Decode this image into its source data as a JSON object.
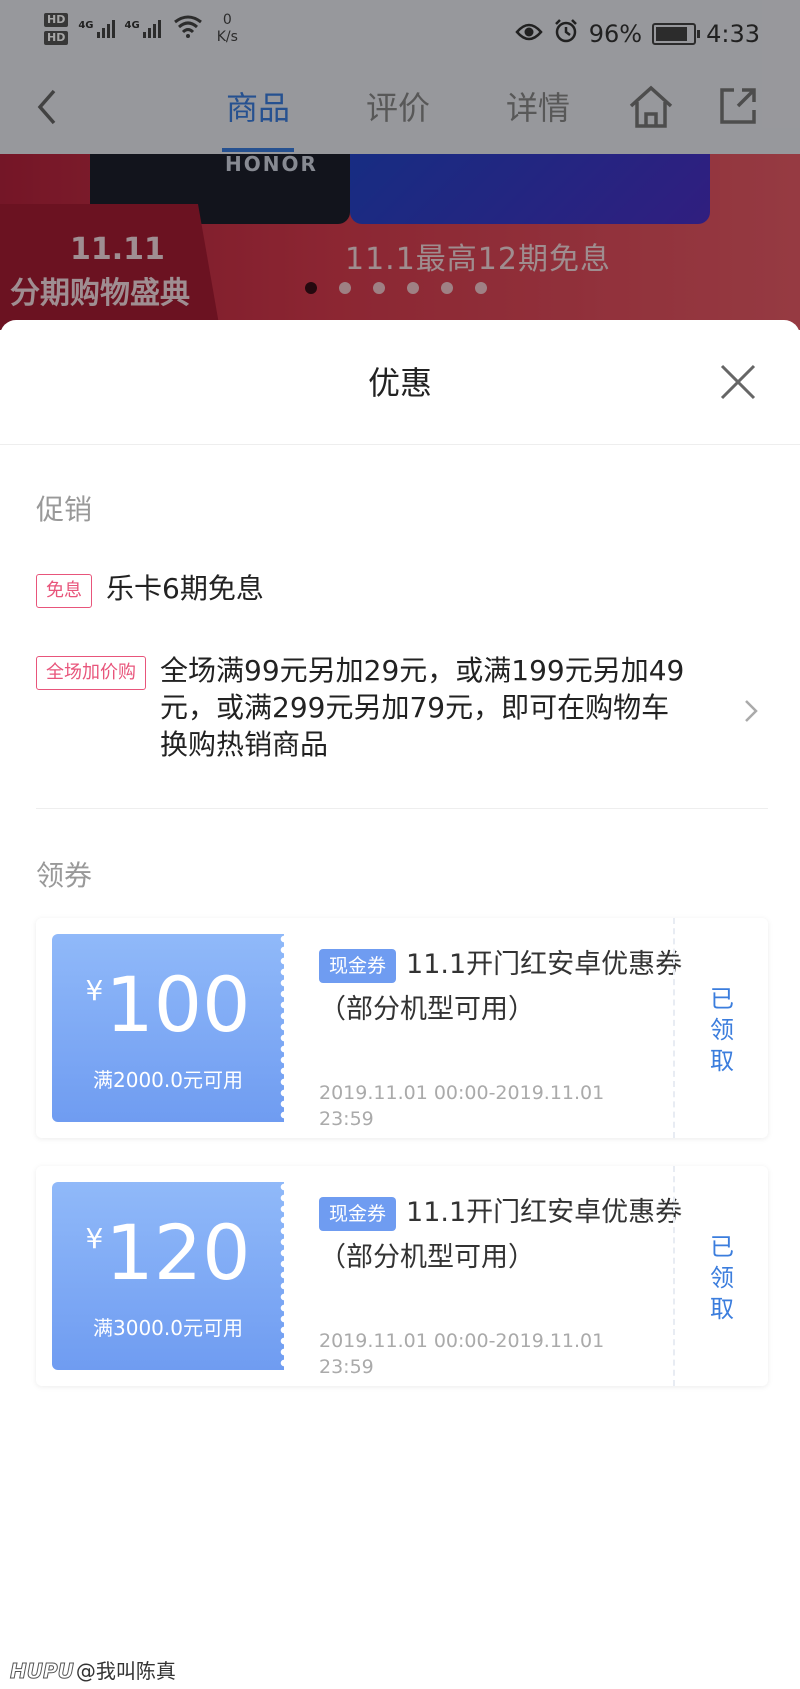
{
  "status_bar": {
    "hd1": "HD",
    "hd2": "HD",
    "signal1_label": "4G",
    "signal2_label": "4G",
    "net_speed": "0",
    "net_unit": "K/s",
    "battery": "96%",
    "battery_level": 0.96,
    "time": "4:33",
    "icons": [
      "eye-icon",
      "alarm-icon",
      "wifi-icon",
      "battery-icon"
    ]
  },
  "nav": {
    "tabs": [
      {
        "label": "商品",
        "active": true
      },
      {
        "label": "评价",
        "active": false
      },
      {
        "label": "详情",
        "active": false
      }
    ],
    "icons": [
      "back-icon",
      "home-icon",
      "share-icon"
    ]
  },
  "banner": {
    "brand": "HONOR",
    "label_top": "11.11",
    "label_bottom": "分期购物盛典",
    "text": "11.1最高12期免息",
    "active_dot": 0,
    "dot_count": 6
  },
  "sheet": {
    "title": "优惠",
    "promo_section": {
      "title": "促销",
      "items": [
        {
          "tag": "免息",
          "text": "乐卡6期免息"
        },
        {
          "tag": "全场加价购",
          "text": "全场满99元另加29元，或满199元另加49元，或满299元另加79元，即可在购物车换购热销商品"
        }
      ]
    },
    "coupon_section": {
      "title": "领券",
      "coupons": [
        {
          "currency": "¥",
          "amount": "100",
          "condition": "满2000.0元可用",
          "tag": "现金券",
          "name": "11.1开门红安卓优惠券（部分机型可用）",
          "validity": "2019.11.01 00:00-2019.11.01 23:59",
          "status": "已领取"
        },
        {
          "currency": "¥",
          "amount": "120",
          "condition": "满3000.0元可用",
          "tag": "现金券",
          "name": "11.1开门红安卓优惠券（部分机型可用）",
          "validity": "2019.11.01 00:00-2019.11.01 23:59",
          "status": "已领取"
        }
      ]
    }
  },
  "watermark": {
    "brand": "HUPU",
    "user": "@我叫陈真"
  },
  "colors": {
    "accent": "#3b7ddd",
    "promo_tag": "#e8557b",
    "coupon_gradient_top": "#90b9f9",
    "coupon_gradient_bottom": "#6f9cf1"
  }
}
